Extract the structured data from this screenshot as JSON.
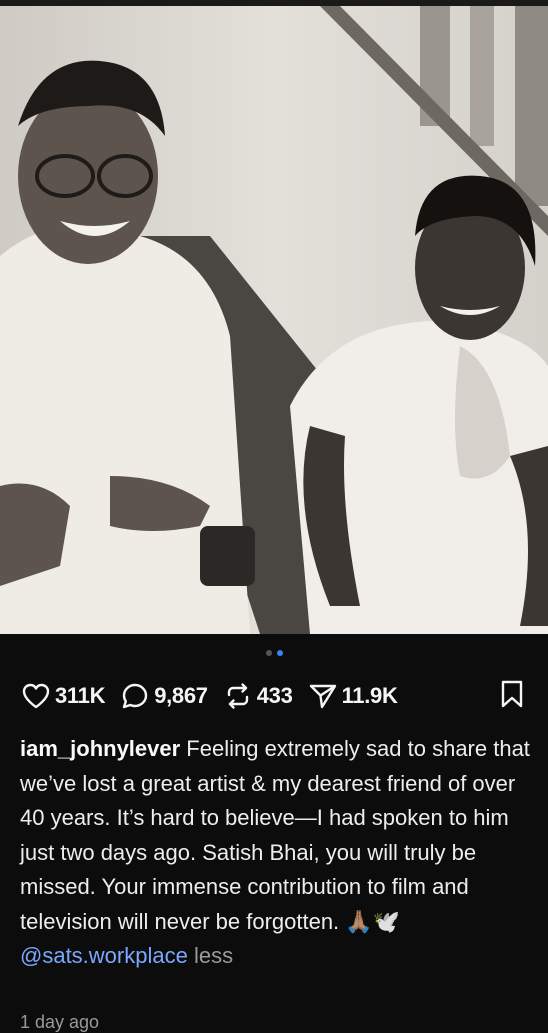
{
  "post": {
    "carousel": {
      "total": 2,
      "active_index": 1
    },
    "actions": {
      "likes": "311K",
      "comments": "9,867",
      "reposts": "433",
      "shares": "11.9K"
    },
    "caption": {
      "username": "iam_johnylever",
      "text": " Feeling extremely sad to share that we’ve lost a great artist & my dearest friend of over 40 years. It’s hard to believe—I had spoken to him just two days ago. Satish Bhai, you will truly be missed. Your immense contribution to film and television will never be forgotten. 🙏🏽🕊️ ",
      "mention": "@sats.workplace",
      "less_label": " less"
    },
    "timestamp": "1 day ago"
  },
  "icons": {
    "like": "heart-icon",
    "comment": "comment-bubble-icon",
    "repost": "repost-icon",
    "share": "send-icon",
    "save": "bookmark-icon"
  },
  "colors": {
    "background": "#0c0c0c",
    "active_dot": "#3b82f6",
    "mention": "#7ba7ff"
  }
}
